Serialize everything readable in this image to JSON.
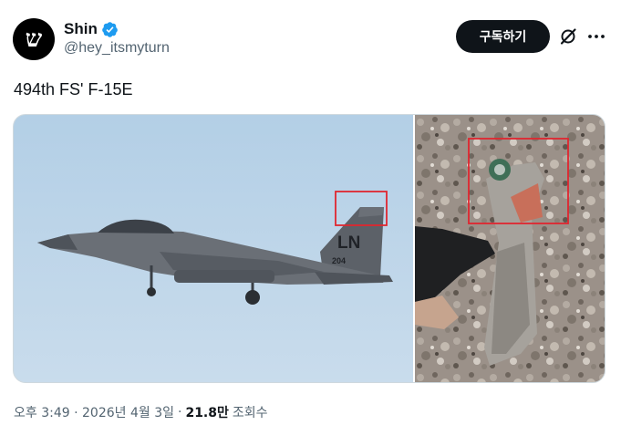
{
  "author": {
    "display_name": "Shin",
    "handle": "@hey_itsmyturn",
    "avatar_glyph": "ש",
    "verified": true
  },
  "actions": {
    "subscribe_label": "구독하기",
    "grok_icon": "grok-icon",
    "more_icon": "more-horizontal-icon"
  },
  "tweet": {
    "text": "494th FS' F-15E"
  },
  "media": {
    "left_tail_code": "LN",
    "left_tail_number": "204"
  },
  "meta": {
    "time": "오후 3:49",
    "separator": "·",
    "date": "2026년 4월 3일",
    "views_number": "21.8만",
    "views_label": "조회수"
  },
  "colors": {
    "text_primary": "#0f1419",
    "text_secondary": "#536471",
    "verified_blue": "#1d9bf0",
    "highlight_box": "#e0262f"
  }
}
